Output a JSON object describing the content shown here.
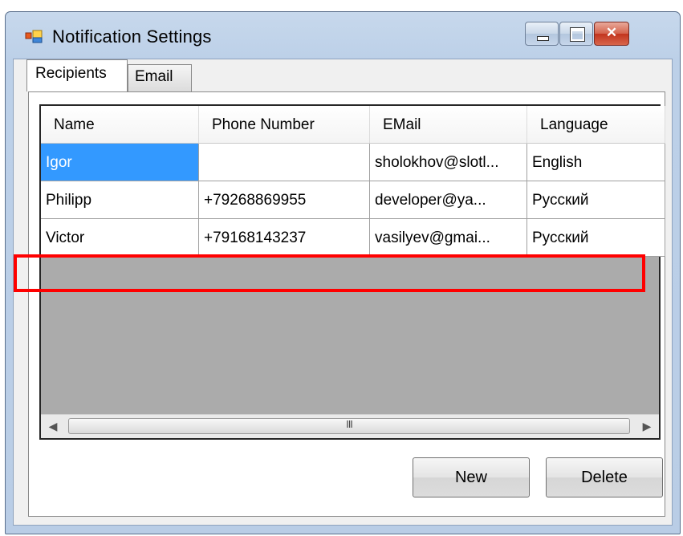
{
  "window": {
    "title": "Notification Settings",
    "controls": {
      "minimize": "minimize",
      "maximize": "maximize",
      "close": "✕"
    }
  },
  "tabs": [
    {
      "label": "Recipients",
      "active": true
    },
    {
      "label": "Email",
      "active": false
    }
  ],
  "grid": {
    "columns": [
      "Name",
      "Phone Number",
      "EMail",
      "Language"
    ],
    "rows": [
      {
        "name": "Igor",
        "phone": "",
        "email": "sholokhov@slotl...",
        "language": "English",
        "selected_cell": "name"
      },
      {
        "name": "Philipp",
        "phone": "+79268869955",
        "email": "developer@ya...",
        "language": "Русский"
      },
      {
        "name": "Victor",
        "phone": "+79168143237",
        "email": "vasilyev@gmai...",
        "language": "Русский",
        "highlighted": true
      }
    ],
    "scrollbar_grip": "III"
  },
  "buttons": {
    "new_label": "New",
    "delete_label": "Delete"
  },
  "colors": {
    "selection": "#3399ff",
    "highlight": "#ff0000",
    "grid_empty": "#ababab"
  }
}
